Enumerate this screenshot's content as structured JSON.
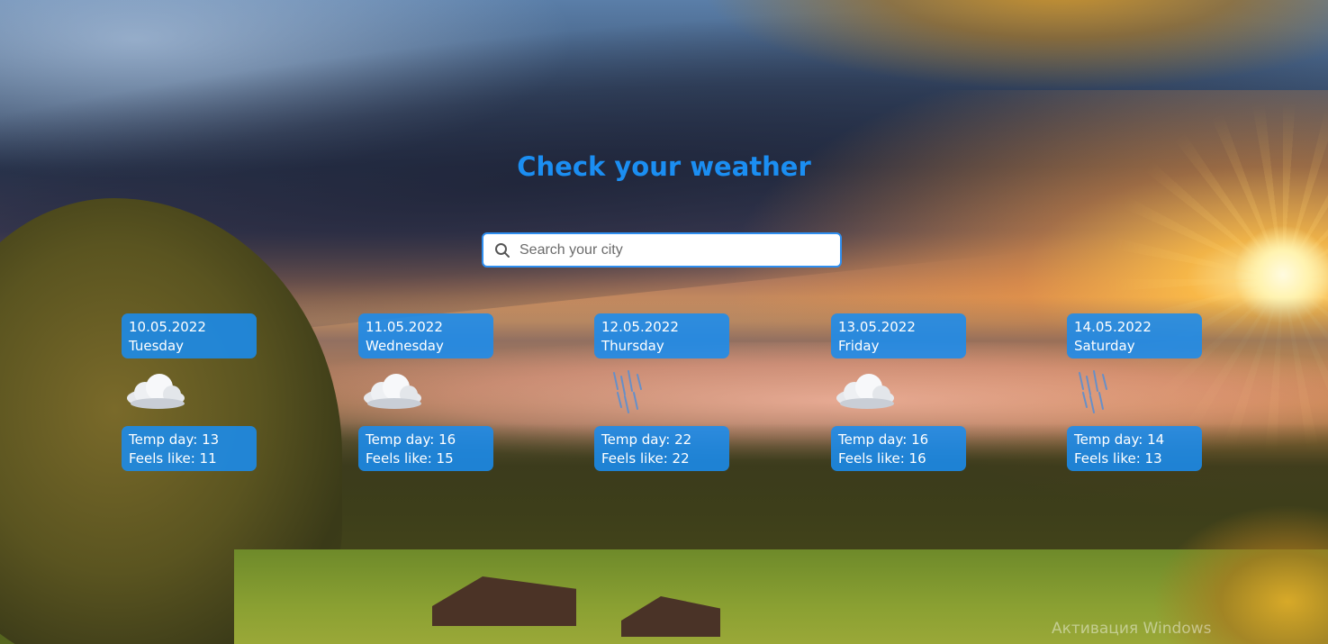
{
  "header": {
    "title": "Check your weather"
  },
  "search": {
    "placeholder": "Search your city",
    "value": ""
  },
  "forecast": [
    {
      "date": "10.05.2022",
      "weekday": "Tuesday",
      "icon": "cloudy-icon",
      "temp_day": "Temp day: 13",
      "feels_like": "Feels like: 11"
    },
    {
      "date": "11.05.2022",
      "weekday": "Wednesday",
      "icon": "cloudy-icon",
      "temp_day": "Temp day: 16",
      "feels_like": "Feels like: 15"
    },
    {
      "date": "12.05.2022",
      "weekday": "Thursday",
      "icon": "rain-icon",
      "temp_day": "Temp day: 22",
      "feels_like": "Feels like: 22"
    },
    {
      "date": "13.05.2022",
      "weekday": "Friday",
      "icon": "cloudy-icon",
      "temp_day": "Temp day: 16",
      "feels_like": "Feels like: 16"
    },
    {
      "date": "14.05.2022",
      "weekday": "Saturday",
      "icon": "rain-icon",
      "temp_day": "Temp day: 14",
      "feels_like": "Feels like: 13"
    }
  ],
  "watermark": "Активация Windows",
  "colors": {
    "accent": "#1b8ef2",
    "card": "#1a8cee",
    "card_text": "#ffffff"
  }
}
